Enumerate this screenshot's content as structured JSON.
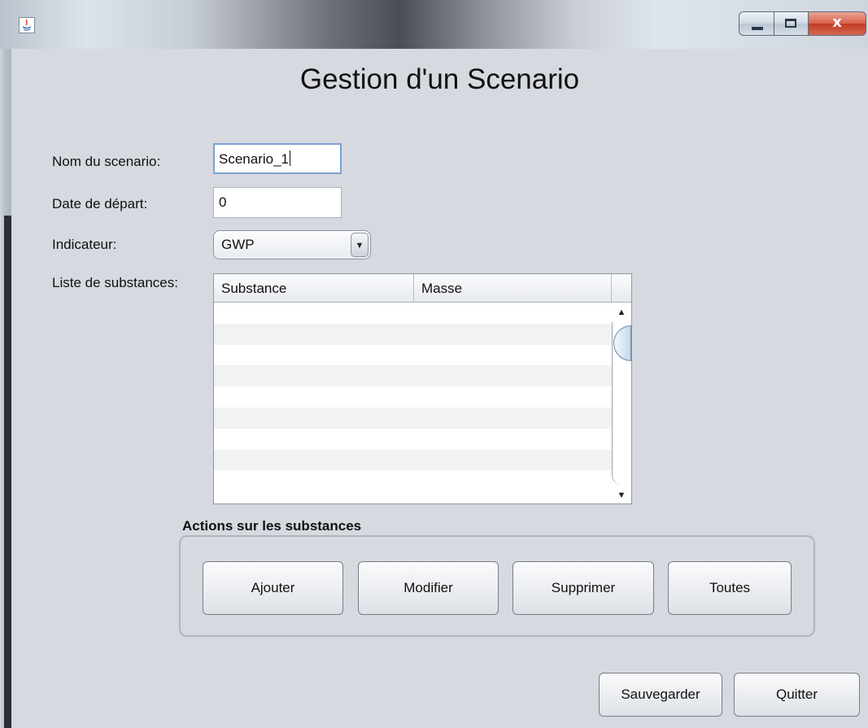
{
  "window": {
    "app_icon": "java-icon",
    "controls": {
      "minimize": "minimize-icon",
      "maximize": "maximize-icon",
      "close_glyph": "x"
    }
  },
  "form": {
    "title": "Gestion d'un Scenario",
    "name_label": "Nom du scenario:",
    "name_value": "Scenario_1",
    "date_label": "Date de départ:",
    "date_value": "0",
    "indicator_label": "Indicateur:",
    "indicator_value": "GWP",
    "substances_label": "Liste de substances:"
  },
  "table": {
    "columns": [
      "Substance",
      "Masse"
    ],
    "rows": []
  },
  "actions": {
    "group_title": "Actions sur les substances",
    "add": "Ajouter",
    "modify": "Modifier",
    "delete": "Supprimer",
    "all": "Toutes"
  },
  "footer": {
    "save": "Sauvegarder",
    "quit": "Quitter"
  },
  "colors": {
    "background": "#d6d9df",
    "close_button": "#c33a22",
    "focus_border": "#7aa2d2"
  }
}
